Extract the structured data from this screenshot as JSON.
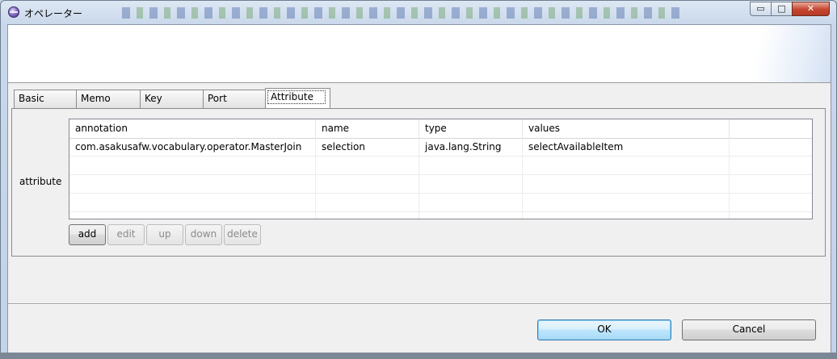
{
  "window": {
    "title": "オペレーター",
    "min_glyph": "▭",
    "max_glyph": "□",
    "close_glyph": "✕"
  },
  "tabs": [
    {
      "label": "Basic",
      "active": false
    },
    {
      "label": "Memo",
      "active": false
    },
    {
      "label": "Key",
      "active": false
    },
    {
      "label": "Port",
      "active": false
    },
    {
      "label": "Attribute",
      "active": true
    }
  ],
  "attribute_panel": {
    "field_label": "attribute",
    "columns": [
      "annotation",
      "name",
      "type",
      "values",
      ""
    ],
    "rows": [
      [
        "com.asakusafw.vocabulary.operator.MasterJoin",
        "selection",
        "java.lang.String",
        "selectAvailableItem",
        ""
      ],
      [
        "",
        "",
        "",
        "",
        ""
      ],
      [
        "",
        "",
        "",
        "",
        ""
      ],
      [
        "",
        "",
        "",
        "",
        ""
      ],
      [
        "",
        "",
        "",
        "",
        ""
      ]
    ],
    "buttons": {
      "add": "add",
      "edit": "edit",
      "up": "up",
      "down": "down",
      "delete": "delete"
    }
  },
  "dialog_buttons": {
    "ok": "OK",
    "cancel": "Cancel"
  }
}
